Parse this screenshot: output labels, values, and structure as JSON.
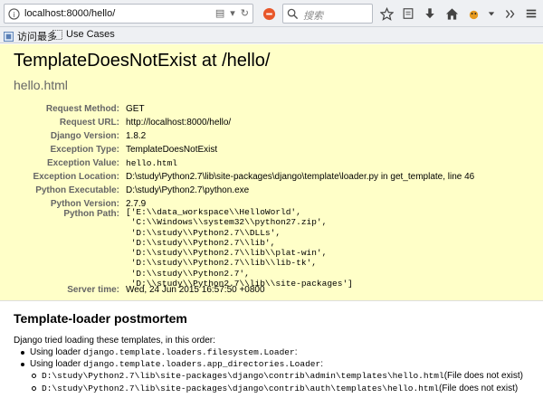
{
  "browser": {
    "url": "localhost:8000/hello/",
    "search_placeholder": "搜索",
    "bookmarks": [
      {
        "label": "访问最多"
      },
      {
        "label": "Use Cases"
      }
    ]
  },
  "error": {
    "title": "TemplateDoesNotExist at /hello/",
    "subtitle": "hello.html",
    "meta": [
      {
        "label": "Request Method:",
        "value": "GET"
      },
      {
        "label": "Request URL:",
        "value": "http://localhost:8000/hello/"
      },
      {
        "label": "Django Version:",
        "value": "1.8.2"
      },
      {
        "label": "Exception Type:",
        "value": "TemplateDoesNotExist"
      },
      {
        "label": "Exception Value:",
        "value": "hello.html"
      },
      {
        "label": "Exception Location:",
        "value": "D:\\study\\Python2.7\\lib\\site-packages\\django\\template\\loader.py in get_template, line 46"
      },
      {
        "label": "Python Executable:",
        "value": "D:\\study\\Python2.7\\python.exe"
      },
      {
        "label": "Python Version:",
        "value": "2.7.9"
      }
    ],
    "python_path_label": "Python Path:",
    "python_path": [
      "['E:\\\\data_workspace\\\\HelloWorld',",
      " 'C:\\\\Windows\\\\system32\\\\python27.zip',",
      " 'D:\\\\study\\\\Python2.7\\\\DLLs',",
      " 'D:\\\\study\\\\Python2.7\\\\lib',",
      " 'D:\\\\study\\\\Python2.7\\\\lib\\\\plat-win',",
      " 'D:\\\\study\\\\Python2.7\\\\lib\\\\lib-tk',",
      " 'D:\\\\study\\\\Python2.7',",
      " 'D:\\\\study\\\\Python2.7\\\\lib\\\\site-packages']"
    ],
    "server_time_label": "Server time:",
    "server_time": "Wed, 24 Jun 2015 16:57:50 +0800"
  },
  "postmortem": {
    "title": "Template-loader postmortem",
    "intro": "Django tried loading these templates, in this order:",
    "using_loader_text": "Using loader ",
    "loaders": [
      {
        "name": "django.template.loaders.filesystem.Loader",
        "suffix": ":"
      },
      {
        "name": "django.template.loaders.app_directories.Loader",
        "suffix": ":"
      }
    ],
    "attempts": [
      {
        "path": "D:\\study\\Python2.7\\lib\\site-packages\\django\\contrib\\admin\\templates\\hello.html",
        "status": " (File does not exist)"
      },
      {
        "path": "D:\\study\\Python2.7\\lib\\site-packages\\django\\contrib\\auth\\templates\\hello.html",
        "status": " (File does not exist)"
      }
    ]
  }
}
